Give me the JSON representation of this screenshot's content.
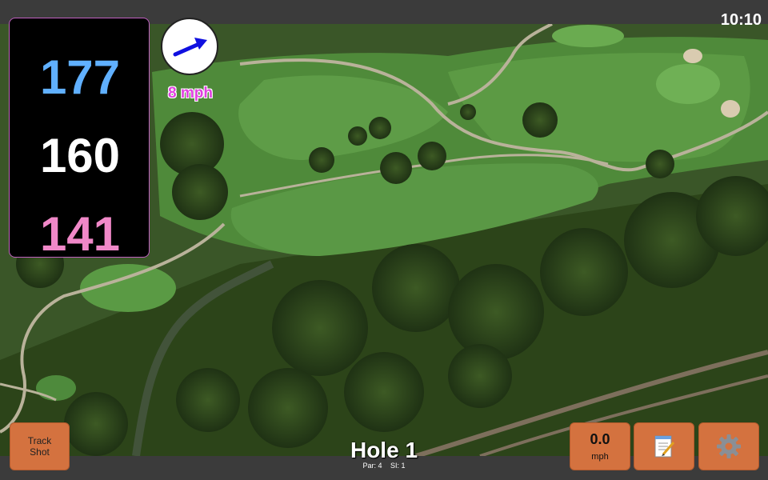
{
  "status": {
    "time": "10:10"
  },
  "distances": {
    "back": "177",
    "middle": "160",
    "front": "141",
    "colors": {
      "back": "#60b0ff",
      "middle": "#ffffff",
      "front": "#f088c8"
    }
  },
  "wind": {
    "speed_label": "8 mph",
    "arrow_color": "#1010e0",
    "icon": "wind-arrow-icon"
  },
  "hole": {
    "title": "Hole 1",
    "par_label": "Par: 4",
    "si_label": "SI: 1"
  },
  "buttons": {
    "track_line1": "Track",
    "track_line2": "Shot",
    "speed_value": "0.0",
    "speed_unit": "mph",
    "notes_icon": "notepad-icon",
    "settings_icon": "gear-icon",
    "accent": "#d4723f"
  }
}
